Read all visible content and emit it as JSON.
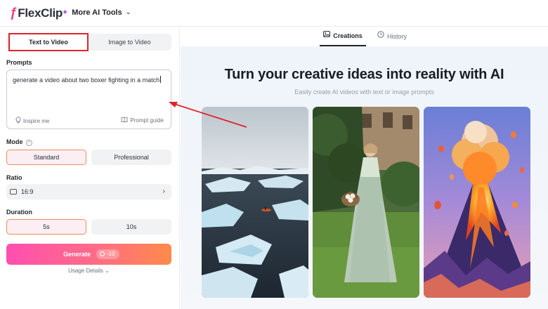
{
  "app": {
    "logo_text": "FlexClip",
    "ai_tools_label": "More AI Tools"
  },
  "left_panel": {
    "tabs": [
      "Text to Video",
      "Image to Video"
    ],
    "active_tab": "Text to Video",
    "prompts_label": "Prompts",
    "prompt_value": "generate a video about two boxer fighting in a match",
    "inspire_label": "Inspire me",
    "guide_label": "Prompt guide",
    "mode_label": "Mode",
    "mode_options": [
      "Standard",
      "Professional"
    ],
    "mode_selected": "Standard",
    "ratio_label": "Ratio",
    "ratio_value": "16:9",
    "duration_label": "Duration",
    "duration_options": [
      "5s",
      "10s"
    ],
    "duration_selected": "5s",
    "generate_label": "Generate",
    "generate_cost": "-10",
    "usage_label": "Usage Details"
  },
  "right_panel": {
    "tabs": [
      "Creations",
      "History"
    ],
    "active_tab": "Creations",
    "headline": "Turn your creative ideas into reality with AI",
    "subheadline": "Easily create AI videos with text or image prompts",
    "samples": [
      "icebergs-kayak",
      "woman-egg-basket",
      "volcano-balloons"
    ]
  },
  "colors": {
    "accent_pink": "#ff4fb0",
    "accent_orange": "#ff8a4a",
    "annotation_red": "#e0232b"
  }
}
